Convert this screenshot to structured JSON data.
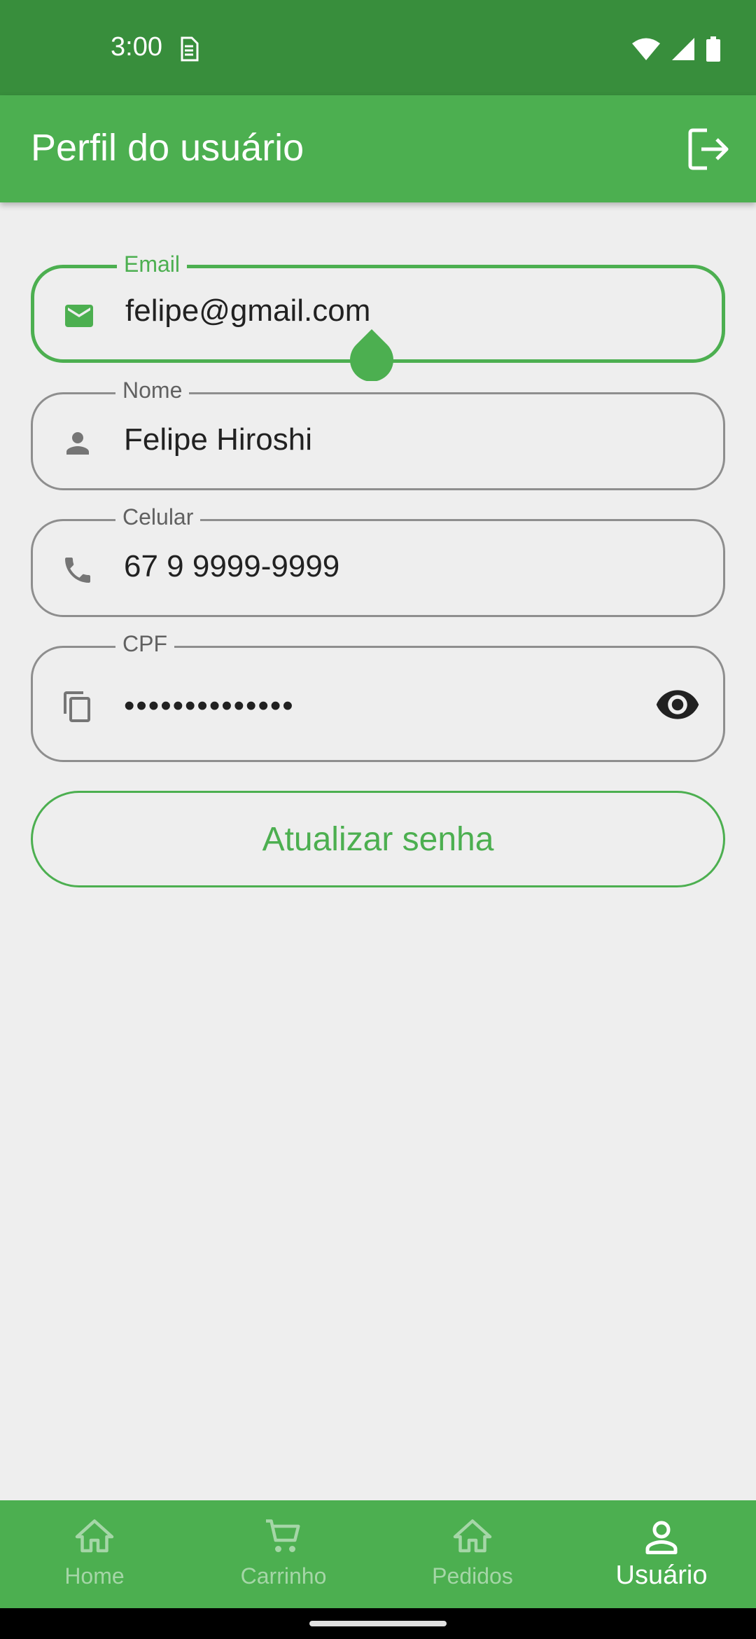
{
  "status_bar": {
    "time": "3:00"
  },
  "app_bar": {
    "title": "Perfil do usuário"
  },
  "form": {
    "email": {
      "label": "Email",
      "value": "felipe@gmail.com"
    },
    "nome": {
      "label": "Nome",
      "value": "Felipe Hiroshi"
    },
    "celular": {
      "label": "Celular",
      "value": "67 9 9999-9999"
    },
    "cpf": {
      "label": "CPF",
      "value": "••••••••••••••"
    },
    "update_button": "Atualizar senha"
  },
  "bottom_nav": {
    "items": [
      {
        "label": "Home",
        "icon": "home-icon",
        "active": false
      },
      {
        "label": "Carrinho",
        "icon": "cart-icon",
        "active": false
      },
      {
        "label": "Pedidos",
        "icon": "home-icon",
        "active": false
      },
      {
        "label": "Usuário",
        "icon": "person-icon",
        "active": true
      }
    ]
  },
  "colors": {
    "primary": "#4caf50",
    "primary_dark": "#388e3c",
    "background": "#eeeeee"
  }
}
